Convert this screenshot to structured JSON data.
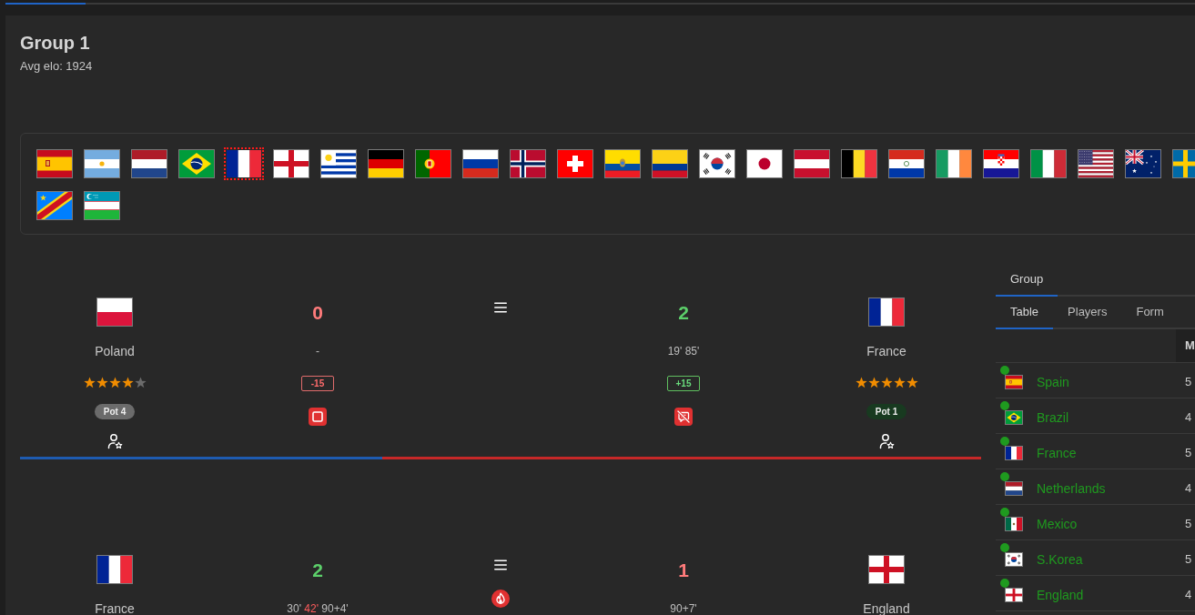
{
  "top_progress": {
    "level": 0.067
  },
  "group": {
    "title": "Group 1",
    "avg_elo": "Avg elo: 1924"
  },
  "flags": [
    {
      "kind": "spain",
      "selected": false
    },
    {
      "kind": "argentina",
      "selected": false
    },
    {
      "kind": "netherlands",
      "selected": false
    },
    {
      "kind": "brazil",
      "selected": false
    },
    {
      "kind": "france",
      "selected": true
    },
    {
      "kind": "england",
      "selected": false
    },
    {
      "kind": "uruguay",
      "selected": false
    },
    {
      "kind": "germany",
      "selected": false
    },
    {
      "kind": "portugal",
      "selected": false
    },
    {
      "kind": "russia",
      "selected": false
    },
    {
      "kind": "norway",
      "selected": false
    },
    {
      "kind": "switzerland",
      "selected": false
    },
    {
      "kind": "ecuador",
      "selected": false
    },
    {
      "kind": "colombia",
      "selected": false
    },
    {
      "kind": "korea",
      "selected": false
    },
    {
      "kind": "japan",
      "selected": false
    },
    {
      "kind": "austria",
      "selected": false
    },
    {
      "kind": "belgium",
      "selected": false
    },
    {
      "kind": "paraguay",
      "selected": false
    },
    {
      "kind": "ireland",
      "selected": false
    },
    {
      "kind": "croatia",
      "selected": false
    },
    {
      "kind": "italy",
      "selected": false
    },
    {
      "kind": "usa",
      "selected": false
    },
    {
      "kind": "australia",
      "selected": false
    },
    {
      "kind": "sweden",
      "selected": false
    },
    {
      "kind": "drcongo",
      "selected": false
    },
    {
      "kind": "uzbekistan",
      "selected": false
    }
  ],
  "matches": [
    {
      "home": {
        "flag": {
          "kind": "poland"
        },
        "name": "Poland",
        "stars": 4,
        "pot": {
          "label": "Pot 4",
          "color": "#6b6b6b"
        },
        "user_icon": true,
        "score": "0",
        "won": false,
        "goals": [
          {
            "text": "-",
            "highlighted": false
          }
        ],
        "elo_change": "-15",
        "event_icon": {
          "kind": "square"
        }
      },
      "away": {
        "flag": {
          "kind": "france"
        },
        "name": "France",
        "stars": 5,
        "pot": {
          "label": "Pot 1",
          "color": "#183a20"
        },
        "user_icon": true,
        "score": "2",
        "won": true,
        "goals": [
          {
            "text": "19'",
            "highlighted": false
          },
          {
            "text": "85'",
            "highlighted": false
          }
        ],
        "elo_change": "+15",
        "event_icon": {
          "kind": "chat_off"
        }
      },
      "probability_bar": {
        "level": 0.377
      }
    },
    {
      "home": {
        "flag": {
          "kind": "france"
        },
        "name": "France",
        "score": "2",
        "won": true,
        "goals": [
          {
            "text": "30'",
            "highlighted": false
          },
          {
            "text": "42'",
            "highlighted": true
          },
          {
            "text": "90+4'",
            "highlighted": false
          }
        ]
      },
      "away": {
        "flag": {
          "kind": "england"
        },
        "name": "England",
        "score": "1",
        "won": false,
        "goals": [
          {
            "text": "90+7'",
            "highlighted": false
          }
        ]
      },
      "center_icon": {
        "kind": "flame"
      }
    }
  ],
  "side_panel": {
    "group_tabs": [
      {
        "label": "Group",
        "selected": true
      }
    ],
    "view_tabs": [
      {
        "label": "Table",
        "selected": true
      },
      {
        "label": "Players",
        "selected": false
      },
      {
        "label": "Form",
        "selected": false
      }
    ],
    "table": {
      "columns": [
        {
          "label": "M"
        }
      ],
      "rows": [
        {
          "flag": {
            "kind": "spain"
          },
          "team": "Spain",
          "color": "#1f9a1f",
          "values": [
            "5"
          ]
        },
        {
          "flag": {
            "kind": "brazil"
          },
          "team": "Brazil",
          "color": "#1f9a1f",
          "values": [
            "4"
          ]
        },
        {
          "flag": {
            "kind": "france"
          },
          "team": "France",
          "color": "#1f9a1f",
          "values": [
            "5"
          ]
        },
        {
          "flag": {
            "kind": "netherlands"
          },
          "team": "Netherlands",
          "color": "#1f9a1f",
          "values": [
            "4"
          ]
        },
        {
          "flag": {
            "kind": "mexico"
          },
          "team": "Mexico",
          "color": "#1f9a1f",
          "values": [
            "5"
          ]
        },
        {
          "flag": {
            "kind": "korea"
          },
          "team": "S.Korea",
          "color": "#1f9a1f",
          "values": [
            "5"
          ]
        },
        {
          "flag": {
            "kind": "england"
          },
          "team": "England",
          "color": "#1f9a1f",
          "values": [
            "4"
          ]
        }
      ]
    }
  }
}
